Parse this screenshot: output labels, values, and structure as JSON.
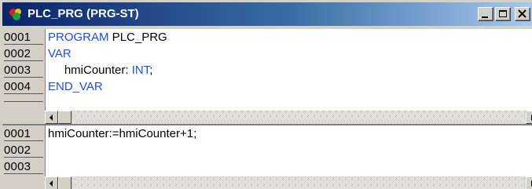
{
  "window": {
    "title": "PLC_PRG (PRG-ST)",
    "icon": "plc-program-icon",
    "buttons": [
      "minimize",
      "maximize",
      "close"
    ]
  },
  "declaration": {
    "lines": [
      {
        "num": "0001",
        "tokens": [
          {
            "text": "PROGRAM",
            "kw": true
          },
          {
            "text": " PLC_PRG",
            "kw": false
          }
        ]
      },
      {
        "num": "0002",
        "tokens": [
          {
            "text": "VAR",
            "kw": true
          }
        ]
      },
      {
        "num": "0003",
        "tokens": [
          {
            "text": "     hmiCounter: ",
            "kw": false
          },
          {
            "text": "INT",
            "kw": true
          },
          {
            "text": ";",
            "kw": false
          }
        ]
      },
      {
        "num": "0004",
        "tokens": [
          {
            "text": "END_VAR",
            "kw": true
          }
        ]
      }
    ]
  },
  "body": {
    "lines": [
      {
        "num": "0001",
        "text": "hmiCounter:=hmiCounter+1;"
      },
      {
        "num": "0002",
        "text": ""
      },
      {
        "num": "0003",
        "text": ""
      }
    ]
  },
  "colors": {
    "keyword": "#1f4fe0",
    "titlebar_start": "#0a246a",
    "titlebar_end": "#a6caf0"
  }
}
